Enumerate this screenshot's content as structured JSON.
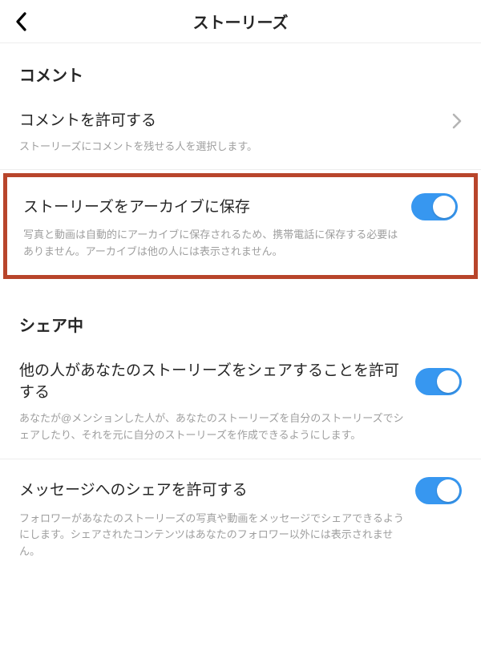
{
  "header": {
    "title": "ストーリーズ"
  },
  "sections": {
    "comments": {
      "heading": "コメント",
      "allow": {
        "label": "コメントを許可する",
        "desc": "ストーリーズにコメントを残せる人を選択します。"
      }
    },
    "archive": {
      "label": "ストーリーズをアーカイブに保存",
      "desc": "写真と動画は自動的にアーカイブに保存されるため、携帯電話に保存する必要はありません。アーカイブは他の人には表示されません。"
    },
    "sharing": {
      "heading": "シェア中",
      "allowReshare": {
        "label": "他の人があなたのストーリーズをシェアすることを許可する",
        "desc": "あなたが@メンションした人が、あなたのストーリーズを自分のストーリーズでシェアしたり、それを元に自分のストーリーズを作成できるようにします。"
      },
      "allowMessageShare": {
        "label": "メッセージへのシェアを許可する",
        "desc": "フォロワーがあなたのストーリーズの写真や動画をメッセージでシェアできるようにします。シェアされたコンテンツはあなたのフォロワー以外には表示されません。"
      }
    }
  },
  "colors": {
    "accent": "#3797f0",
    "highlight": "#b8452b"
  }
}
